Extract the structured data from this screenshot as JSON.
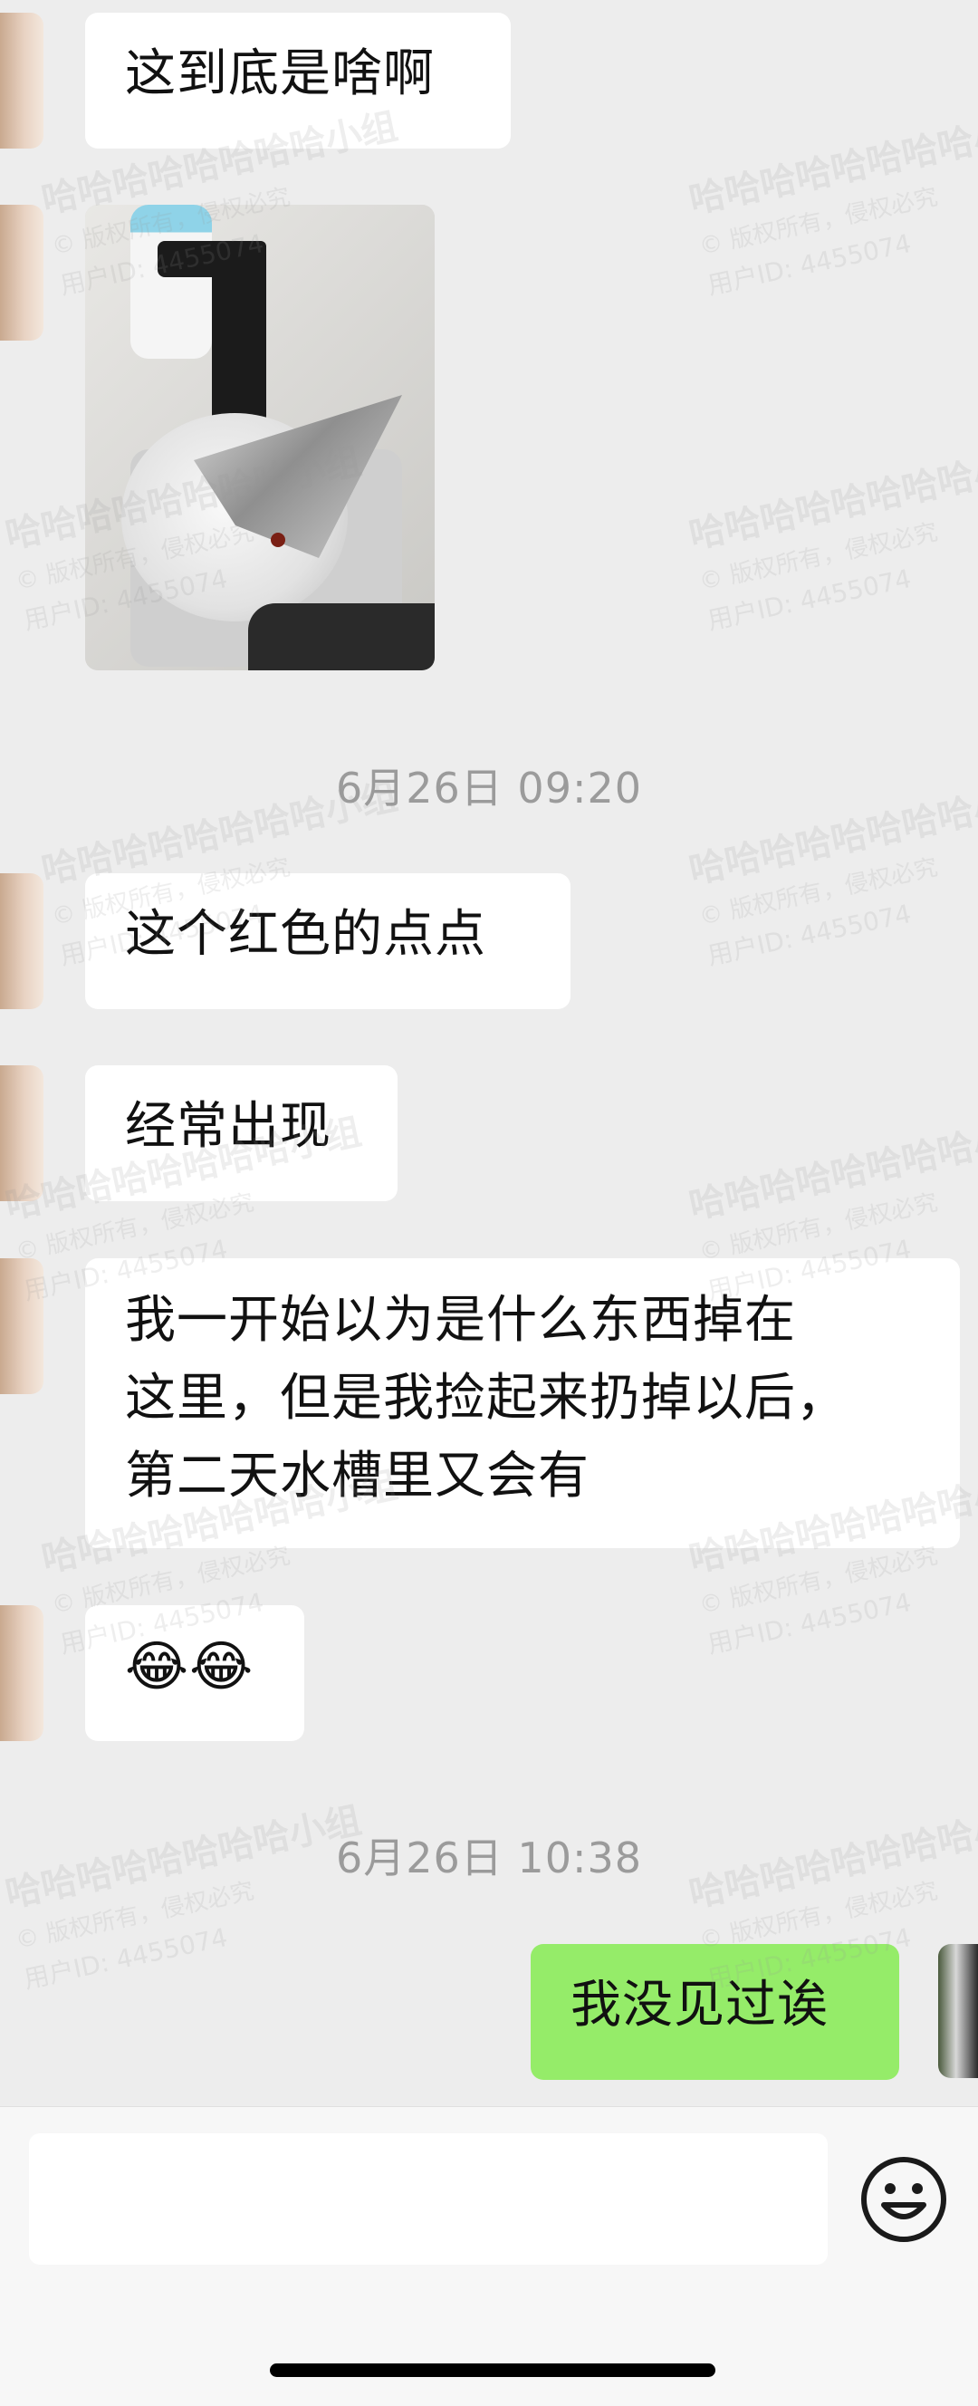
{
  "messages": [
    {
      "text": "这到底是啥啊"
    },
    {
      "text": "这个红色的点点"
    },
    {
      "text": "经常出现"
    },
    {
      "text": "我一开始以为是什么东西掉在\n这里，但是我捡起来扔掉以后，\n第二天水槽里又会有"
    },
    {
      "text": "😂😂"
    },
    {
      "text": "我没见过诶"
    }
  ],
  "timestamps": [
    "6月26日 09:20",
    "6月26日 10:38"
  ],
  "photo": {
    "icon": "sink-photo"
  },
  "input": {
    "placeholder": ""
  },
  "emoji_button": {
    "icon": "smiley-face-icon"
  },
  "watermark": {
    "group": "哈哈哈哈哈哈哈哈小组",
    "rights": "© 版权所有，侵权必究",
    "user": "用户ID: 4455074"
  },
  "colors": {
    "background": "#ededed",
    "incoming": "#ffffff",
    "outgoing": "#95ec69",
    "timestamp": "#9b9b9b"
  }
}
